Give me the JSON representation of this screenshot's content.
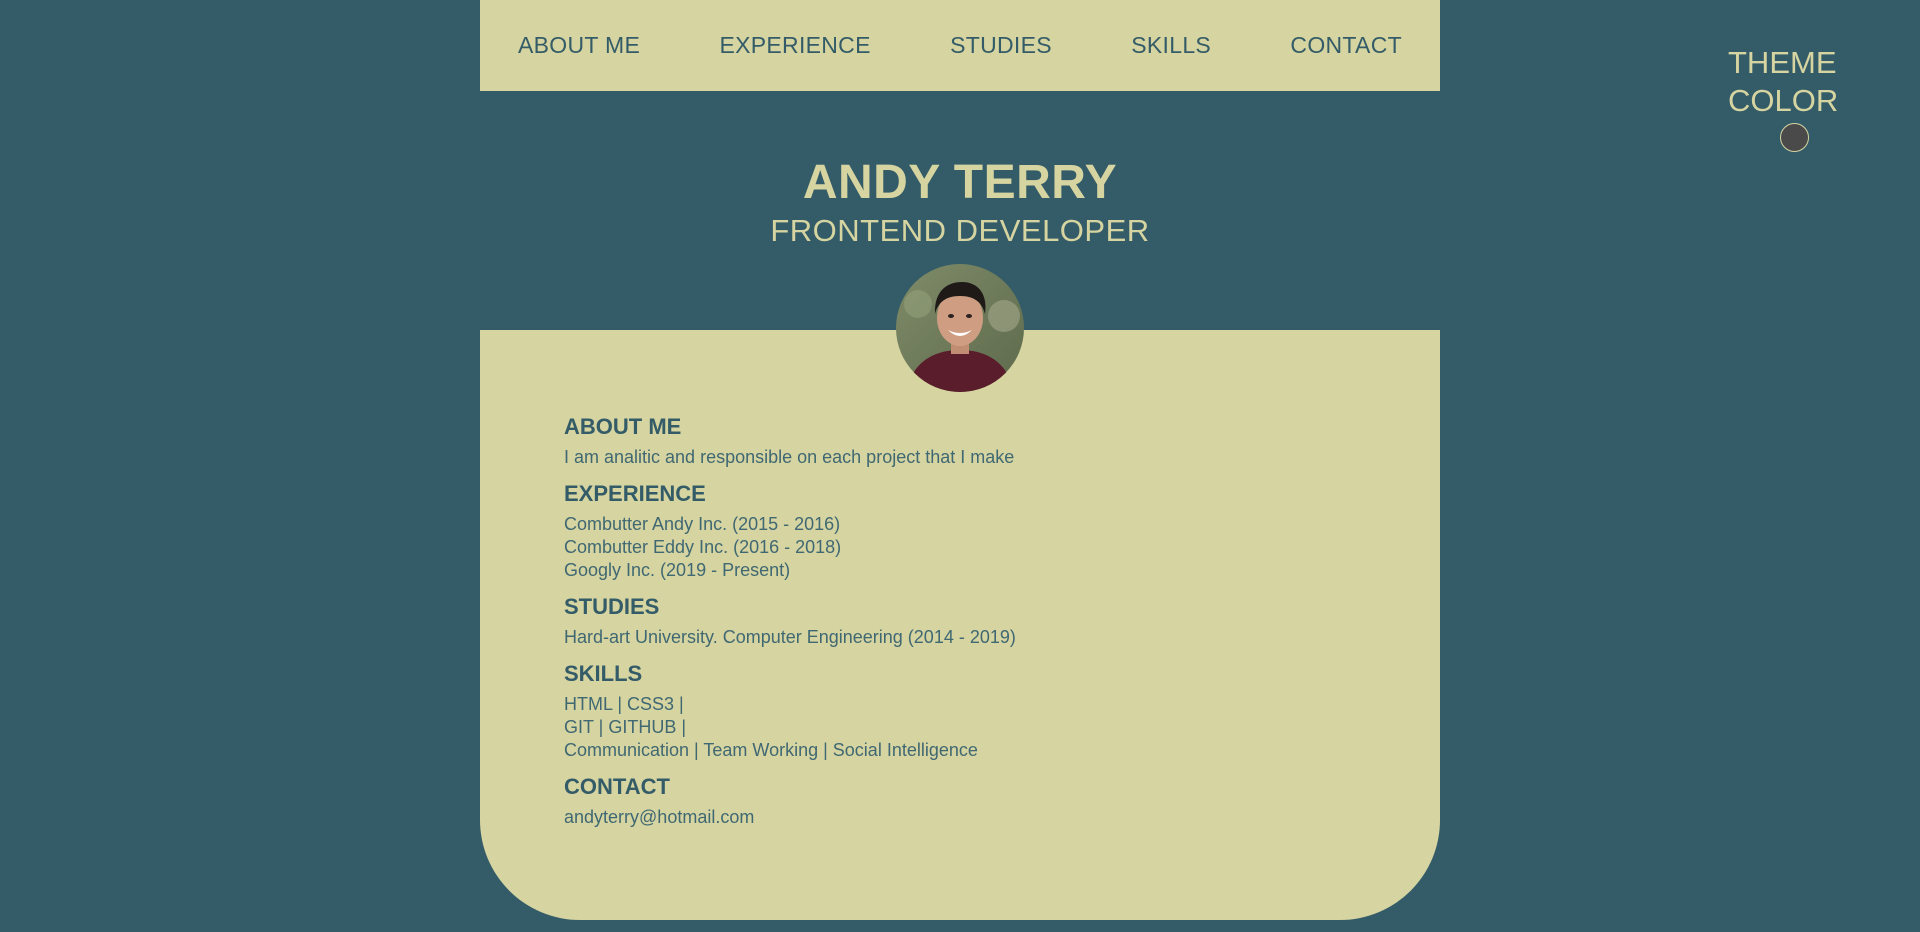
{
  "nav": {
    "items": [
      {
        "label": "ABOUT ME"
      },
      {
        "label": "EXPERIENCE"
      },
      {
        "label": "STUDIES"
      },
      {
        "label": "SKILLS"
      },
      {
        "label": "CONTACT"
      }
    ]
  },
  "theme": {
    "line1": "THEME",
    "line2": "COLOR",
    "swatch_color": "#4a4a4a"
  },
  "profile": {
    "name": "ANDY TERRY",
    "role": "FRONTEND DEVELOPER"
  },
  "sections": {
    "about": {
      "heading": "ABOUT ME",
      "lines": [
        "I am analitic and responsible on each project that I make"
      ]
    },
    "experience": {
      "heading": "EXPERIENCE",
      "lines": [
        "Combutter Andy Inc. (2015 - 2016)",
        "Combutter Eddy Inc. (2016 - 2018)",
        "Googly Inc. (2019 - Present)"
      ]
    },
    "studies": {
      "heading": "STUDIES",
      "lines": [
        "Hard-art University. Computer Engineering (2014 - 2019)"
      ]
    },
    "skills": {
      "heading": "SKILLS",
      "lines": [
        "HTML | CSS3 |",
        "GIT | GITHUB |",
        "Communication | Team Working | Social Intelligence"
      ]
    },
    "contact": {
      "heading": "CONTACT",
      "lines": [
        "andyterry@hotmail.com"
      ]
    }
  },
  "colors": {
    "background": "#345c68",
    "accent": "#d6d4a0"
  }
}
